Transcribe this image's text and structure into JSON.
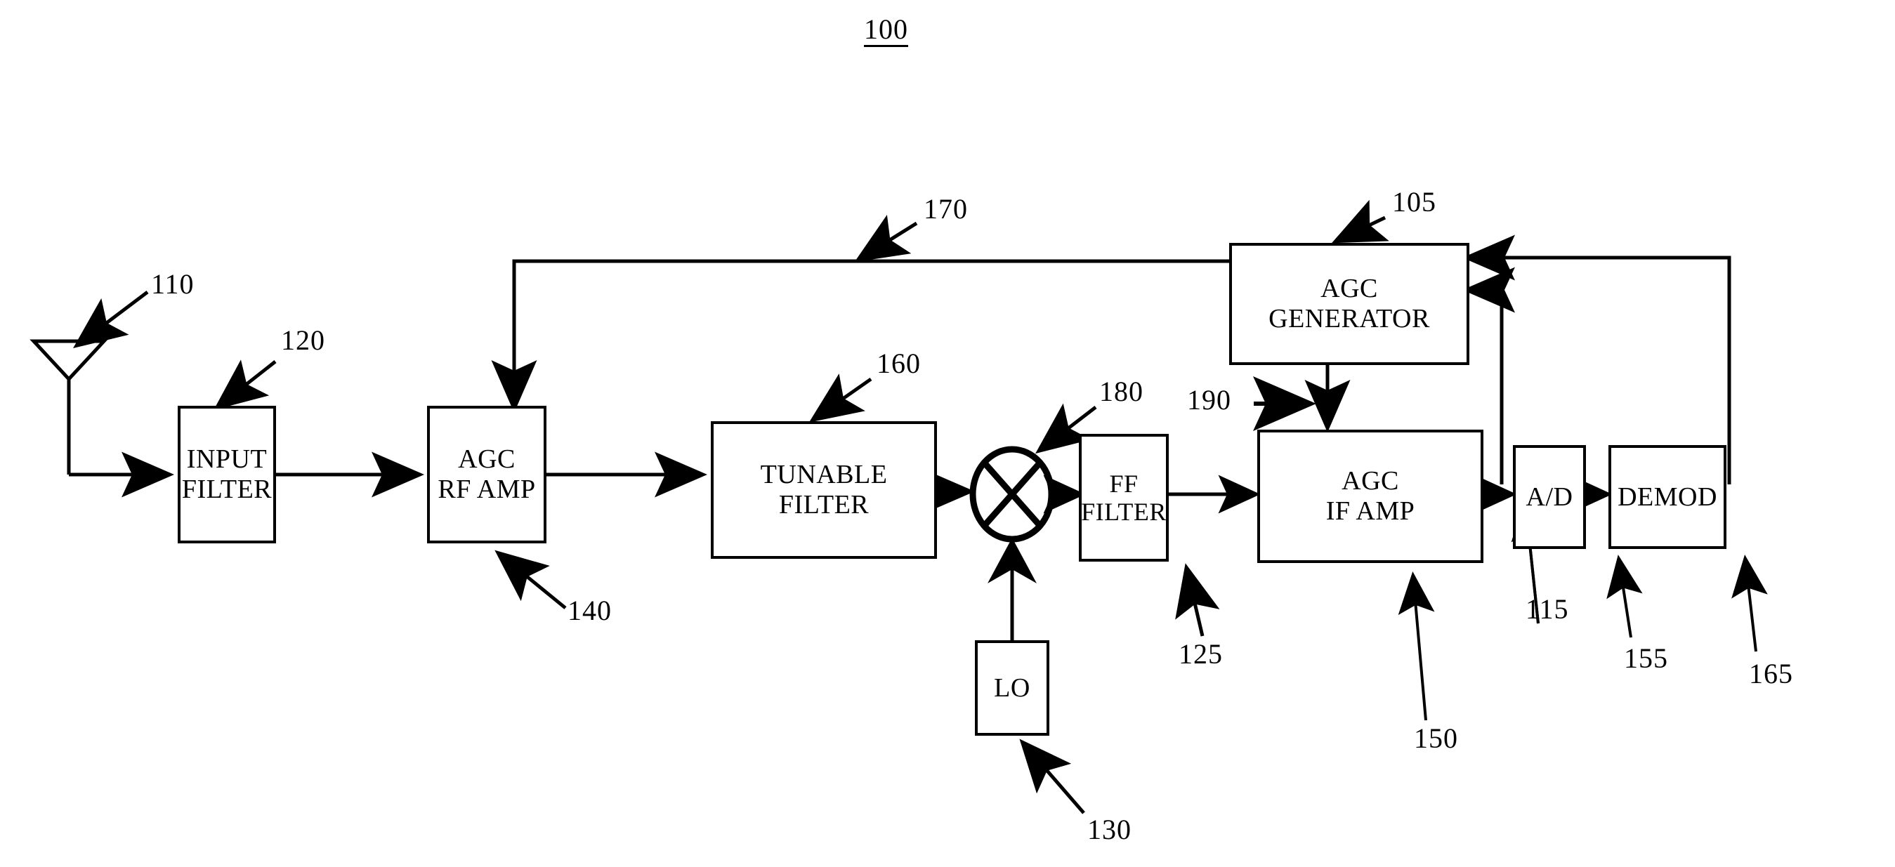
{
  "figure": {
    "number": "100",
    "type": "block-diagram",
    "title_underlined": true
  },
  "blocks": [
    {
      "id": "input-filter",
      "line1": "INPUT",
      "line2": "FILTER",
      "ref": "120"
    },
    {
      "id": "agc-rf-amp",
      "line1": "AGC",
      "line2": "RF AMP",
      "ref": "140"
    },
    {
      "id": "tunable-filter",
      "line1": "TUNABLE",
      "line2": "FILTER",
      "ref": "160"
    },
    {
      "id": "ff-filter",
      "line1": "FF",
      "line2": "FILTER",
      "ref": "125"
    },
    {
      "id": "agc-if-amp",
      "line1": "AGC",
      "line2": "IF AMP",
      "ref": "150"
    },
    {
      "id": "agc-generator",
      "line1": "AGC",
      "line2": "GENERATOR",
      "ref": "105"
    },
    {
      "id": "ad-converter",
      "line1": "A/D",
      "line2": "",
      "ref": "155"
    },
    {
      "id": "demod",
      "line1": "DEMOD",
      "line2": "",
      "ref": "165"
    },
    {
      "id": "local-oscillator",
      "line1": "LO",
      "line2": "",
      "ref": "130"
    }
  ],
  "symbols": [
    {
      "id": "antenna",
      "kind": "antenna-triangle",
      "ref": "110"
    },
    {
      "id": "mixer",
      "kind": "mixer-circle-x",
      "ref": "180"
    }
  ],
  "reference_numerals": {
    "figure": "100",
    "agc_generator": "105",
    "antenna": "110",
    "if_amp_output_tap": "115",
    "input_filter": "120",
    "ff_filter": "125",
    "local_oscillator": "130",
    "agc_rf_amp": "140",
    "agc_if_amp": "150",
    "ad_converter": "155",
    "tunable_filter": "160",
    "demod": "165",
    "rf_gain_control_line": "170",
    "mixer": "180",
    "if_gain_control_line": "190"
  },
  "labels": {
    "fig": "100",
    "n105": "105",
    "n110": "110",
    "n115": "115",
    "n120": "120",
    "n125": "125",
    "n130": "130",
    "n140": "140",
    "n150": "150",
    "n155": "155",
    "n160": "160",
    "n165": "165",
    "n170": "170",
    "n180": "180",
    "n190": "190"
  },
  "block_text": {
    "input_filter_1": "INPUT",
    "input_filter_2": "FILTER",
    "agc_rf_amp_1": "AGC",
    "agc_rf_amp_2": "RF AMP",
    "tunable_filter_1": "TUNABLE",
    "tunable_filter_2": "FILTER",
    "ff_filter_1": "FF",
    "ff_filter_2": "FILTER",
    "agc_if_amp_1": "AGC",
    "agc_if_amp_2": "IF AMP",
    "agc_generator_1": "AGC",
    "agc_generator_2": "GENERATOR",
    "ad": "A/D",
    "demod": "DEMOD",
    "lo": "LO"
  },
  "signal_flow": [
    "antenna -> INPUT FILTER",
    "INPUT FILTER -> AGC RF AMP",
    "AGC RF AMP -> TUNABLE FILTER",
    "TUNABLE FILTER -> mixer",
    "LO -> mixer",
    "mixer -> FF FILTER",
    "FF FILTER -> AGC IF AMP",
    "AGC IF AMP -> A/D",
    "A/D -> DEMOD",
    "DEMOD -> AGC GENERATOR (feedback)",
    "A/D -> AGC GENERATOR (feedback)",
    "AGC GENERATOR -> AGC RF AMP (line 170)",
    "AGC GENERATOR -> AGC IF AMP (line 190)"
  ],
  "colors": {
    "ink": "#000000",
    "background": "#ffffff"
  }
}
